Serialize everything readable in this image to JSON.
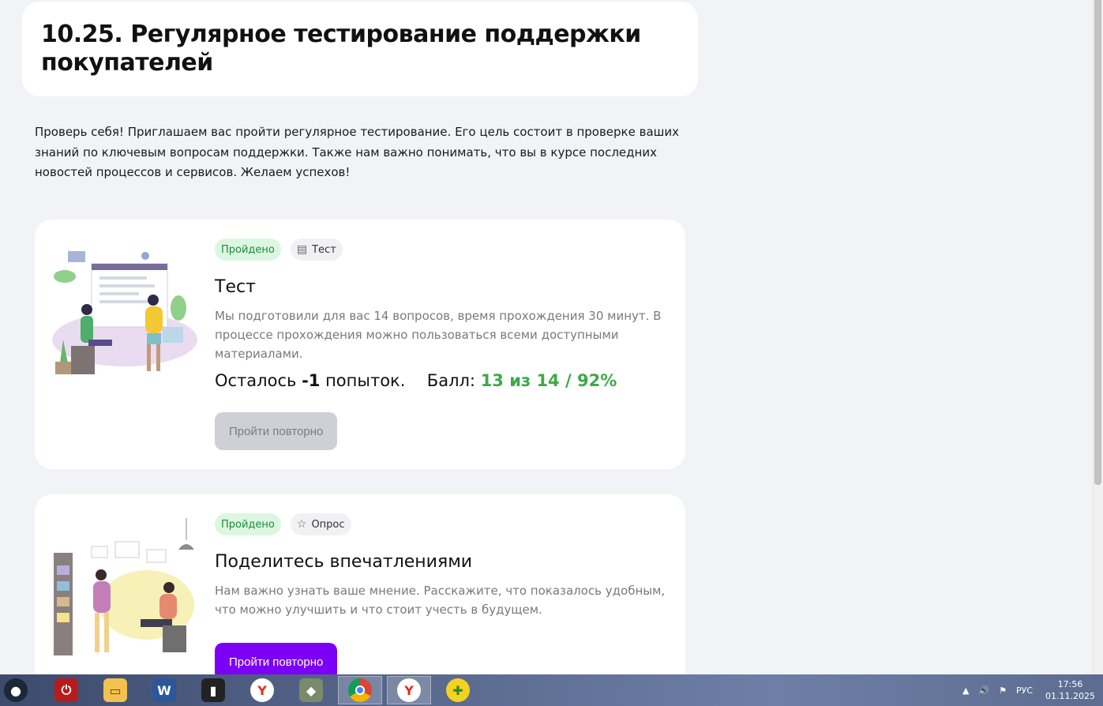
{
  "page": {
    "title": "10.25. Регулярное тестирование поддержки покупателей",
    "intro": "Проверь себя! Приглашаем вас пройти регулярное тестирование. Его цель состоит в проверке ваших знаний по ключевым вопросам поддержки. Также нам важно понимать, что вы в курсе последних новостей процессов и сервисов. Желаем успехов!"
  },
  "cards": [
    {
      "status": "Пройдено",
      "type_label": "Тест",
      "type_icon": "document-icon",
      "title": "Тест",
      "description": "Мы подготовили для вас 14 вопросов, время прохождения 30 минут. В процессе прохождения можно пользоваться всеми доступными материалами.",
      "attempts_prefix": "Осталось",
      "attempts_value": "-1",
      "attempts_suffix": "попыток.",
      "score_label": "Балл:",
      "score_value": "13 из 14 / 92%",
      "button_label": "Пройти повторно",
      "button_state": "disabled"
    },
    {
      "status": "Пройдено",
      "type_label": "Опрос",
      "type_icon": "star-icon",
      "title": "Поделитесь впечатлениями",
      "description": "Нам важно узнать ваше мнение. Расскажите, что показалось удобным, что можно улучшить и что стоит учесть в будущем.",
      "button_label": "Пройти повторно",
      "button_state": "primary"
    }
  ],
  "colors": {
    "accent": "#7b00f5",
    "passed_bg": "#dcf7e1",
    "passed_text": "#1f8a3a",
    "score": "#3fa84a",
    "page_bg": "#f2f3f7"
  },
  "taskbar": {
    "apps": [
      "steam-icon",
      "power-icon",
      "file-explorer-icon",
      "word-icon",
      "stats-icon",
      "yandex-browser-icon",
      "app-icon",
      "chrome-icon",
      "yandex-browser-icon",
      "plus-app-icon"
    ],
    "tray": {
      "language": "РУС",
      "time": "17:56",
      "date": "01.11.2025"
    }
  }
}
